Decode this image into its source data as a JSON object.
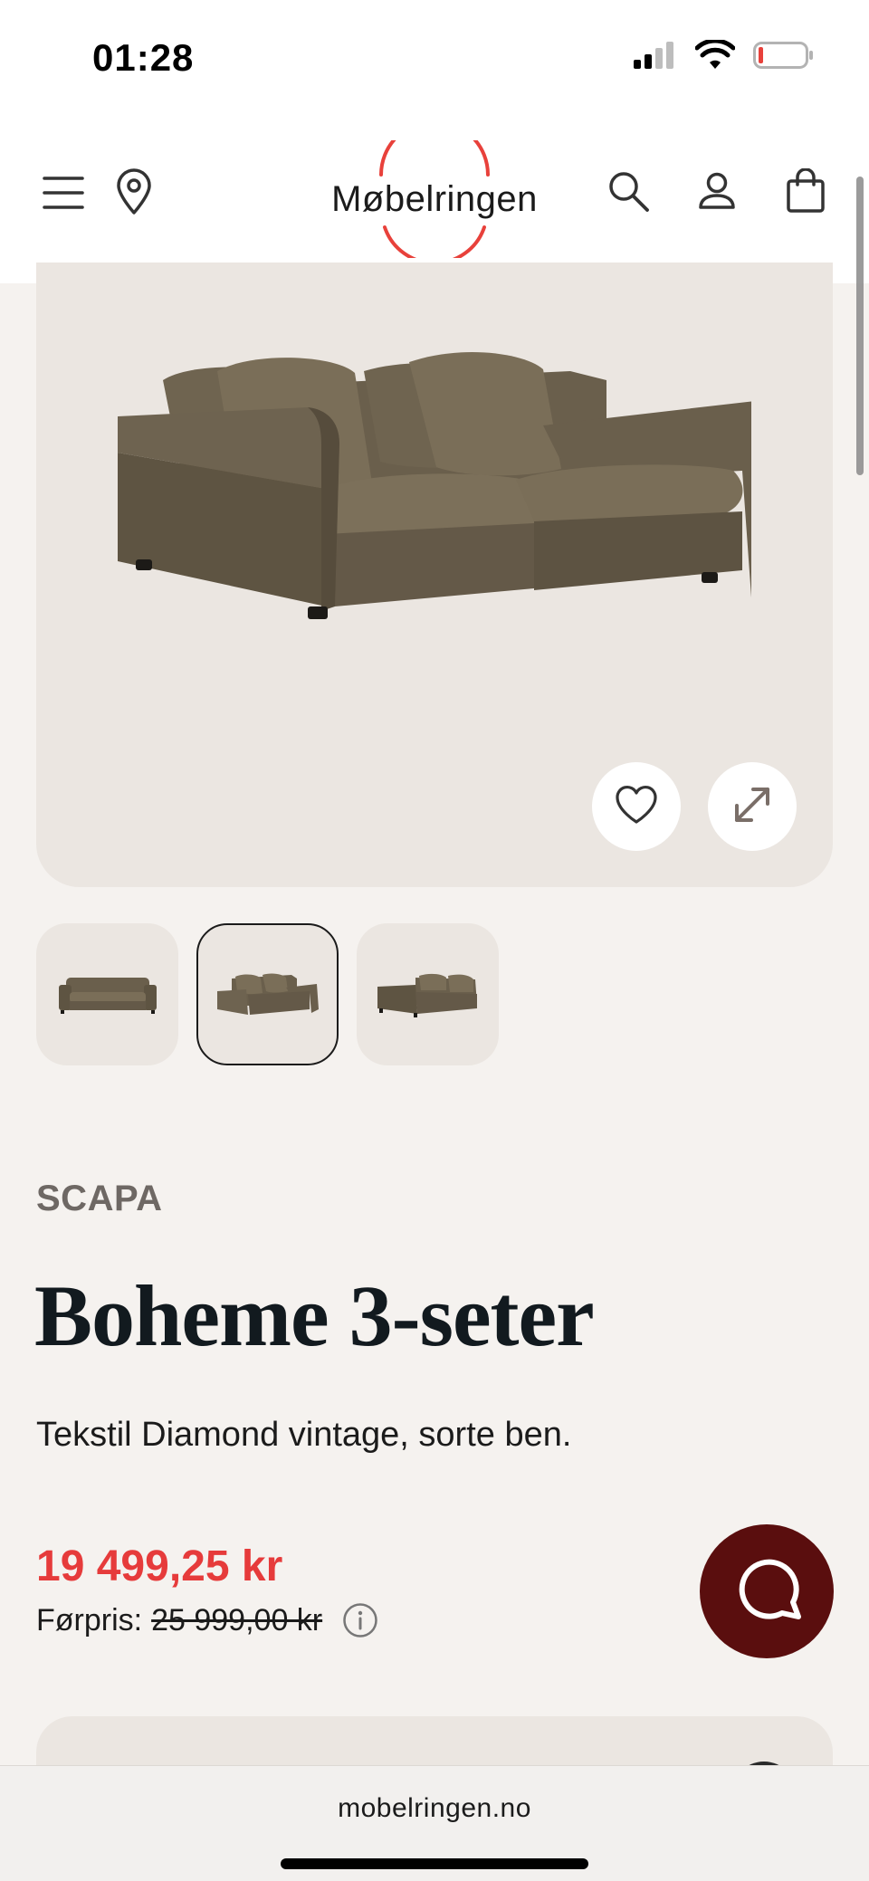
{
  "status_bar": {
    "time": "01:28",
    "icons": [
      "signal-icon",
      "wifi-icon",
      "battery-icon"
    ]
  },
  "header": {
    "logo_text": "Møbelringen",
    "icons": [
      "menu-icon",
      "location-pin-icon",
      "search-icon",
      "user-icon",
      "shopping-bag-icon"
    ],
    "logo_ring_color": "#e8413b"
  },
  "hero": {
    "actions": [
      "heart-icon",
      "expand-icon"
    ]
  },
  "thumbnails": {
    "count": 3,
    "active_index": 1
  },
  "product": {
    "brand": "SCAPA",
    "title": "Boheme 3-seter",
    "description": "Tekstil Diamond vintage, sorte ben.",
    "price": "19 499,25 kr",
    "previous_price_label": "Førpris:",
    "previous_price": "25 999,00 kr",
    "price_color": "#e63b3b"
  },
  "chat": {
    "icon": "chat-icon",
    "color": "#5a0e0e"
  },
  "browser": {
    "url": "mobelringen.no"
  }
}
